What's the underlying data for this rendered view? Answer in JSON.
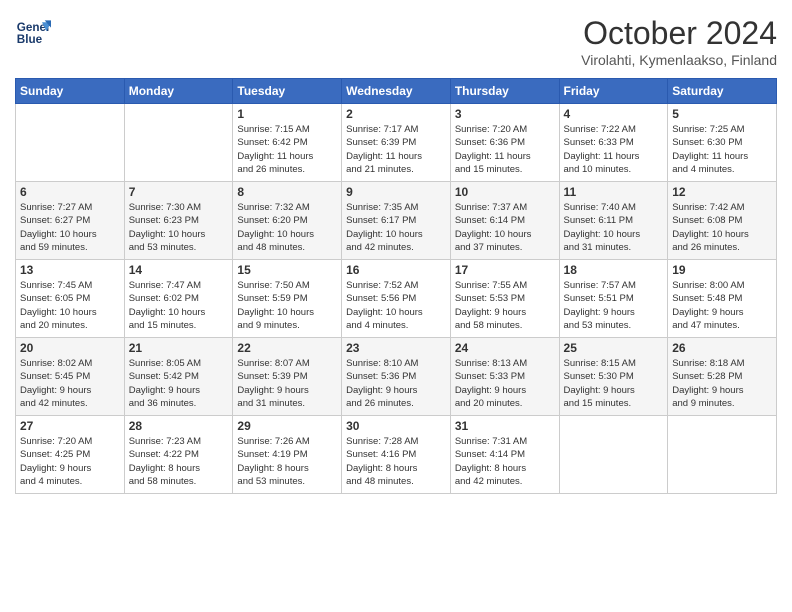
{
  "header": {
    "logo_line1": "General",
    "logo_line2": "Blue",
    "month": "October 2024",
    "location": "Virolahti, Kymenlaakso, Finland"
  },
  "weekdays": [
    "Sunday",
    "Monday",
    "Tuesday",
    "Wednesday",
    "Thursday",
    "Friday",
    "Saturday"
  ],
  "weeks": [
    [
      {
        "day": "",
        "info": ""
      },
      {
        "day": "",
        "info": ""
      },
      {
        "day": "1",
        "info": "Sunrise: 7:15 AM\nSunset: 6:42 PM\nDaylight: 11 hours\nand 26 minutes."
      },
      {
        "day": "2",
        "info": "Sunrise: 7:17 AM\nSunset: 6:39 PM\nDaylight: 11 hours\nand 21 minutes."
      },
      {
        "day": "3",
        "info": "Sunrise: 7:20 AM\nSunset: 6:36 PM\nDaylight: 11 hours\nand 15 minutes."
      },
      {
        "day": "4",
        "info": "Sunrise: 7:22 AM\nSunset: 6:33 PM\nDaylight: 11 hours\nand 10 minutes."
      },
      {
        "day": "5",
        "info": "Sunrise: 7:25 AM\nSunset: 6:30 PM\nDaylight: 11 hours\nand 4 minutes."
      }
    ],
    [
      {
        "day": "6",
        "info": "Sunrise: 7:27 AM\nSunset: 6:27 PM\nDaylight: 10 hours\nand 59 minutes."
      },
      {
        "day": "7",
        "info": "Sunrise: 7:30 AM\nSunset: 6:23 PM\nDaylight: 10 hours\nand 53 minutes."
      },
      {
        "day": "8",
        "info": "Sunrise: 7:32 AM\nSunset: 6:20 PM\nDaylight: 10 hours\nand 48 minutes."
      },
      {
        "day": "9",
        "info": "Sunrise: 7:35 AM\nSunset: 6:17 PM\nDaylight: 10 hours\nand 42 minutes."
      },
      {
        "day": "10",
        "info": "Sunrise: 7:37 AM\nSunset: 6:14 PM\nDaylight: 10 hours\nand 37 minutes."
      },
      {
        "day": "11",
        "info": "Sunrise: 7:40 AM\nSunset: 6:11 PM\nDaylight: 10 hours\nand 31 minutes."
      },
      {
        "day": "12",
        "info": "Sunrise: 7:42 AM\nSunset: 6:08 PM\nDaylight: 10 hours\nand 26 minutes."
      }
    ],
    [
      {
        "day": "13",
        "info": "Sunrise: 7:45 AM\nSunset: 6:05 PM\nDaylight: 10 hours\nand 20 minutes."
      },
      {
        "day": "14",
        "info": "Sunrise: 7:47 AM\nSunset: 6:02 PM\nDaylight: 10 hours\nand 15 minutes."
      },
      {
        "day": "15",
        "info": "Sunrise: 7:50 AM\nSunset: 5:59 PM\nDaylight: 10 hours\nand 9 minutes."
      },
      {
        "day": "16",
        "info": "Sunrise: 7:52 AM\nSunset: 5:56 PM\nDaylight: 10 hours\nand 4 minutes."
      },
      {
        "day": "17",
        "info": "Sunrise: 7:55 AM\nSunset: 5:53 PM\nDaylight: 9 hours\nand 58 minutes."
      },
      {
        "day": "18",
        "info": "Sunrise: 7:57 AM\nSunset: 5:51 PM\nDaylight: 9 hours\nand 53 minutes."
      },
      {
        "day": "19",
        "info": "Sunrise: 8:00 AM\nSunset: 5:48 PM\nDaylight: 9 hours\nand 47 minutes."
      }
    ],
    [
      {
        "day": "20",
        "info": "Sunrise: 8:02 AM\nSunset: 5:45 PM\nDaylight: 9 hours\nand 42 minutes."
      },
      {
        "day": "21",
        "info": "Sunrise: 8:05 AM\nSunset: 5:42 PM\nDaylight: 9 hours\nand 36 minutes."
      },
      {
        "day": "22",
        "info": "Sunrise: 8:07 AM\nSunset: 5:39 PM\nDaylight: 9 hours\nand 31 minutes."
      },
      {
        "day": "23",
        "info": "Sunrise: 8:10 AM\nSunset: 5:36 PM\nDaylight: 9 hours\nand 26 minutes."
      },
      {
        "day": "24",
        "info": "Sunrise: 8:13 AM\nSunset: 5:33 PM\nDaylight: 9 hours\nand 20 minutes."
      },
      {
        "day": "25",
        "info": "Sunrise: 8:15 AM\nSunset: 5:30 PM\nDaylight: 9 hours\nand 15 minutes."
      },
      {
        "day": "26",
        "info": "Sunrise: 8:18 AM\nSunset: 5:28 PM\nDaylight: 9 hours\nand 9 minutes."
      }
    ],
    [
      {
        "day": "27",
        "info": "Sunrise: 7:20 AM\nSunset: 4:25 PM\nDaylight: 9 hours\nand 4 minutes."
      },
      {
        "day": "28",
        "info": "Sunrise: 7:23 AM\nSunset: 4:22 PM\nDaylight: 8 hours\nand 58 minutes."
      },
      {
        "day": "29",
        "info": "Sunrise: 7:26 AM\nSunset: 4:19 PM\nDaylight: 8 hours\nand 53 minutes."
      },
      {
        "day": "30",
        "info": "Sunrise: 7:28 AM\nSunset: 4:16 PM\nDaylight: 8 hours\nand 48 minutes."
      },
      {
        "day": "31",
        "info": "Sunrise: 7:31 AM\nSunset: 4:14 PM\nDaylight: 8 hours\nand 42 minutes."
      },
      {
        "day": "",
        "info": ""
      },
      {
        "day": "",
        "info": ""
      }
    ]
  ]
}
